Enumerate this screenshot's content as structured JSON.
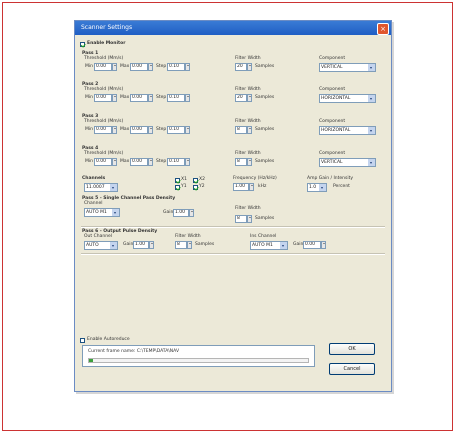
{
  "window": {
    "title": "Scanner Settings",
    "close_glyph": "×"
  },
  "enable_label": "Enable Monitor",
  "passes": [
    {
      "title": "Pass 1",
      "threshold_label": "Threshold (Mm/s)",
      "min_label": "Min",
      "min": "0.00",
      "max_label": "Max",
      "max": "0.00",
      "step_label": "Step",
      "step": "0.10",
      "filter_label": "Filter Width",
      "filter": "20",
      "filter_unit": "Samples",
      "component_label": "Component",
      "component": "VERTICAL"
    },
    {
      "title": "Pass 2",
      "threshold_label": "Threshold (Mm/s)",
      "min_label": "Min",
      "min": "0.00",
      "max_label": "Max",
      "max": "0.00",
      "step_label": "Step",
      "step": "0.10",
      "filter_label": "Filter Width",
      "filter": "20",
      "filter_unit": "Samples",
      "component_label": "Component",
      "component": "HORIZONTAL"
    },
    {
      "title": "Pass 3",
      "threshold_label": "Threshold (Mm/s)",
      "min_label": "Min",
      "min": "0.00",
      "max_label": "Max",
      "max": "0.00",
      "step_label": "Step",
      "step": "0.10",
      "filter_label": "Filter Width",
      "filter": "8",
      "filter_unit": "Samples",
      "component_label": "Component",
      "component": "HORIZONTAL"
    },
    {
      "title": "Pass 4",
      "threshold_label": "Threshold (Mm/s)",
      "min_label": "Min",
      "min": "0.00",
      "max_label": "Max",
      "max": "0.00",
      "step_label": "Step",
      "step": "0.10",
      "filter_label": "Filter Width",
      "filter": "8",
      "filter_unit": "Samples",
      "component_label": "Component",
      "component": "VERTICAL"
    }
  ],
  "channels": {
    "label": "Channels",
    "value": "11.0007",
    "items": [
      {
        "label": "X1",
        "checked": true
      },
      {
        "label": "X2",
        "checked": true
      },
      {
        "label": "Y1",
        "checked": true
      },
      {
        "label": "Y2",
        "checked": true
      }
    ],
    "freq_label": "Frequency (Hz/kHz)",
    "freq_value": "1.00",
    "freq_unit": "kHz",
    "amp_label": "Amp Gain / Intensity",
    "amp_value": "1.0",
    "amp_unit": "Percent"
  },
  "pass5": {
    "title": "Pass 5 - Single Channel Pass Density",
    "channel_label": "Channel",
    "channel_value": "AUTO M1",
    "gain_label": "Gain",
    "gain_value": "1.00",
    "filter_label": "Filter Width",
    "filter_value": "8",
    "filter_unit": "Samples"
  },
  "pass6": {
    "title": "Pass 6 - Output Pulse Density",
    "col1_label": "Out Channel",
    "col1_value": "AUTO",
    "gain_label": "Gain",
    "gain1_value": "1.00",
    "col2_label": "Filter Width",
    "col2_value": "8",
    "col2_unit": "Samples",
    "col3_label": "Ins Channel",
    "col3_value": "AUTO M1",
    "gain2_value": "0.00"
  },
  "enable_autoreduce": "Enable Autoreduce",
  "status_text": "Current frame name: C:\\TEMP\\DATA\\NAV",
  "progress": 0.02,
  "buttons": {
    "ok": "OK",
    "cancel": "Cancel"
  }
}
